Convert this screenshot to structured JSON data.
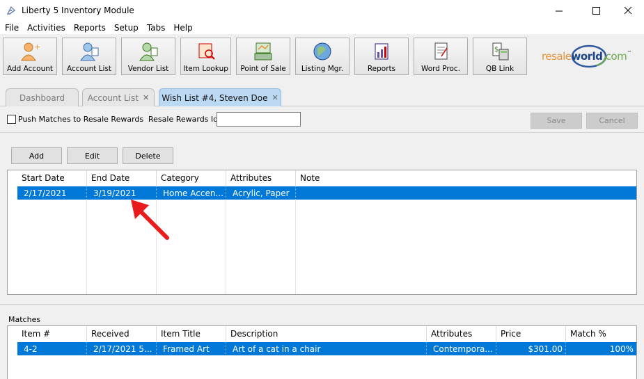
{
  "window": {
    "title": "Liberty 5 Inventory Module"
  },
  "menu": [
    "File",
    "Activities",
    "Reports",
    "Setup",
    "Tabs",
    "Help"
  ],
  "toolbar": [
    {
      "label": "Add Account",
      "icon": "add-account-icon"
    },
    {
      "label": "Account List",
      "icon": "account-list-icon"
    },
    {
      "label": "Vendor List",
      "icon": "vendor-list-icon"
    },
    {
      "label": "Item Lookup",
      "icon": "item-lookup-icon"
    },
    {
      "label": "Point of Sale",
      "icon": "point-of-sale-icon"
    },
    {
      "label": "Listing Mgr.",
      "icon": "listing-manager-icon"
    },
    {
      "label": "Reports",
      "icon": "reports-icon"
    },
    {
      "label": "Word Proc.",
      "icon": "word-processor-icon"
    },
    {
      "label": "QB Link",
      "icon": "qb-link-icon"
    }
  ],
  "logo": {
    "part1": "resale",
    "part2": "world",
    "part3": ".com",
    "tm": "™"
  },
  "tabs": [
    {
      "label": "Dashboard",
      "closable": false
    },
    {
      "label": "Account List",
      "closable": true
    },
    {
      "label": "Wish List #4, Steven Doe",
      "closable": true,
      "active": true
    }
  ],
  "options": {
    "push_label": "Push Matches to Resale Rewards",
    "rr_label": "Resale Rewards Id",
    "rr_value": "",
    "save_label": "Save",
    "cancel_label": "Cancel"
  },
  "actions": {
    "add": "Add",
    "edit": "Edit",
    "delete": "Delete"
  },
  "wishlist": {
    "columns": [
      "Start Date",
      "End Date",
      "Category",
      "Attributes",
      "Note"
    ],
    "rows": [
      [
        "2/17/2021",
        "3/19/2021",
        "Home Accen...",
        "Acrylic, Paper",
        ""
      ]
    ]
  },
  "matches": {
    "label": "Matches",
    "columns": [
      "Item #",
      "Received",
      "Item Title",
      "Description",
      "Attributes",
      "Price",
      "Match %"
    ],
    "rows": [
      [
        "4-2",
        "2/17/2021 5...",
        "Framed Art",
        "Art of a cat in a chair",
        "Contempora...",
        "$301.00",
        "100%"
      ]
    ]
  },
  "colors": {
    "selection": "#0078d7",
    "active_tab": "#bcd9f3",
    "arrow": "#e81c1c"
  }
}
